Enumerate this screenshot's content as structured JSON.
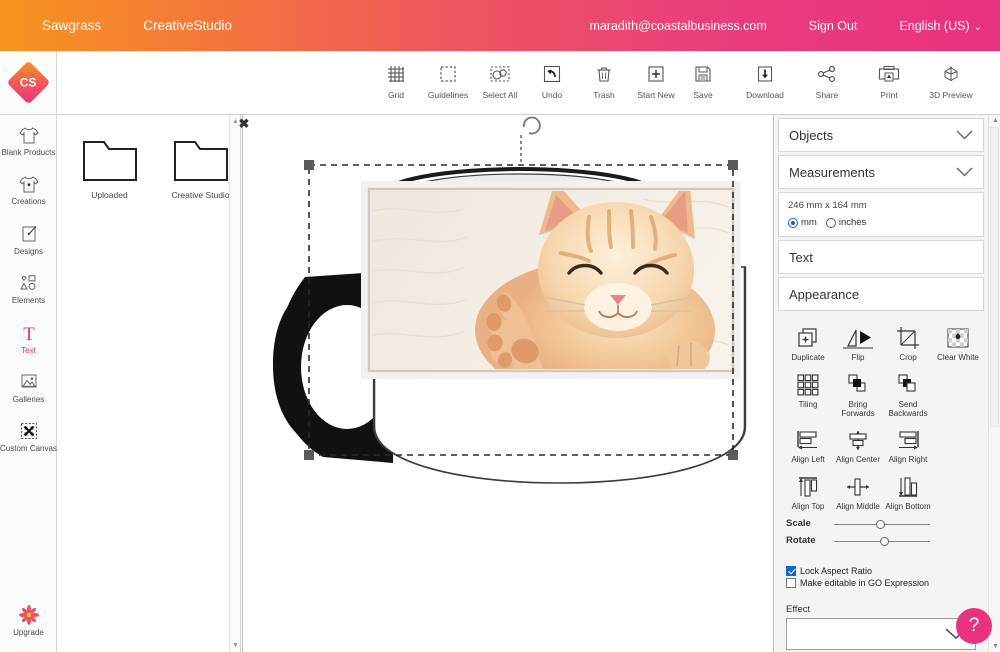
{
  "topbar": {
    "brand": "Sawgrass",
    "product": "CreativeStudio",
    "email": "maradith@coastalbusiness.com",
    "sign_out": "Sign Out",
    "language": "English (US)",
    "accent": "#e8327f"
  },
  "logo": {
    "text": "CS"
  },
  "toolbar": {
    "left_items": [
      {
        "label": "Grid",
        "icon": "grid-icon"
      },
      {
        "label": "Guidelines",
        "icon": "guidelines-icon"
      },
      {
        "label": "Select All",
        "icon": "select-all-icon"
      },
      {
        "label": "Undo",
        "icon": "undo-icon"
      },
      {
        "label": "Trash",
        "icon": "trash-icon"
      },
      {
        "label": "Start New",
        "icon": "plus-icon"
      }
    ],
    "right_items": [
      {
        "label": "Save",
        "icon": "save-icon"
      },
      {
        "label": "Download",
        "icon": "download-icon"
      },
      {
        "label": "Share",
        "icon": "share-icon"
      },
      {
        "label": "Print",
        "icon": "print-icon"
      },
      {
        "label": "3D Preview",
        "icon": "3d-preview-icon"
      }
    ]
  },
  "sidebar": {
    "items": [
      {
        "label": "Blank Products",
        "icon": "tshirt-icon",
        "active": false
      },
      {
        "label": "Creations",
        "icon": "tshirt-heart-icon",
        "active": false
      },
      {
        "label": "Designs",
        "icon": "design-pen-icon",
        "active": false
      },
      {
        "label": "Elements",
        "icon": "shapes-icon",
        "active": false
      },
      {
        "label": "Text",
        "icon": "text-t-icon",
        "active": true
      },
      {
        "label": "Galleries",
        "icon": "image-icon",
        "active": false
      },
      {
        "label": "Custom Canvas",
        "icon": "custom-canvas-icon",
        "active": false
      }
    ],
    "upgrade": {
      "label": "Upgrade",
      "icon": "star-burst-icon"
    }
  },
  "filepanel": {
    "close_label": "✖",
    "folders": [
      {
        "label": "Uploaded",
        "icon": "folder-icon"
      },
      {
        "label": "Creative Studio",
        "icon": "folder-icon"
      }
    ]
  },
  "canvas": {
    "product": "mug",
    "selected_object": "kitten-photo",
    "rotate_handle": "rotate-handle"
  },
  "properties": {
    "sections": [
      {
        "label": "Objects",
        "collapsed": true
      },
      {
        "label": "Measurements",
        "collapsed": false
      },
      {
        "label": "Text",
        "collapsed": true
      },
      {
        "label": "Appearance",
        "collapsed": false
      }
    ],
    "measurements": {
      "dimensions": "246 mm x 164 mm",
      "unit_mm": "mm",
      "unit_inches": "inches",
      "selected_unit": "mm"
    },
    "appearance_tools": [
      [
        {
          "label": "Duplicate",
          "icon": "duplicate-icon"
        },
        {
          "label": "Flip",
          "icon": "flip-icon"
        },
        {
          "label": "Crop",
          "icon": "crop-icon"
        },
        {
          "label": "Clear White",
          "icon": "clear-white-icon"
        }
      ],
      [
        {
          "label": "Tiling",
          "icon": "tiling-icon"
        },
        {
          "label": "Bring Forwards",
          "icon": "bring-forwards-icon"
        },
        {
          "label": "Send Backwards",
          "icon": "send-backwards-icon"
        }
      ],
      [
        {
          "label": "Align Left",
          "icon": "align-left-icon"
        },
        {
          "label": "Align Center",
          "icon": "align-center-icon"
        },
        {
          "label": "Align Right",
          "icon": "align-right-icon"
        }
      ],
      [
        {
          "label": "Align Top",
          "icon": "align-top-icon"
        },
        {
          "label": "Align Middle",
          "icon": "align-middle-icon"
        },
        {
          "label": "Align Bottom",
          "icon": "align-bottom-icon"
        }
      ]
    ],
    "sliders": [
      {
        "label": "Scale",
        "value": 45
      },
      {
        "label": "Rotate",
        "value": 50
      }
    ],
    "checkboxes": [
      {
        "label": "Lock Aspect Ratio",
        "checked": true
      },
      {
        "label": "Make editable in GO Expression",
        "checked": false
      }
    ],
    "effect": {
      "label": "Effect",
      "value": ""
    }
  },
  "help": {
    "label": "?"
  }
}
